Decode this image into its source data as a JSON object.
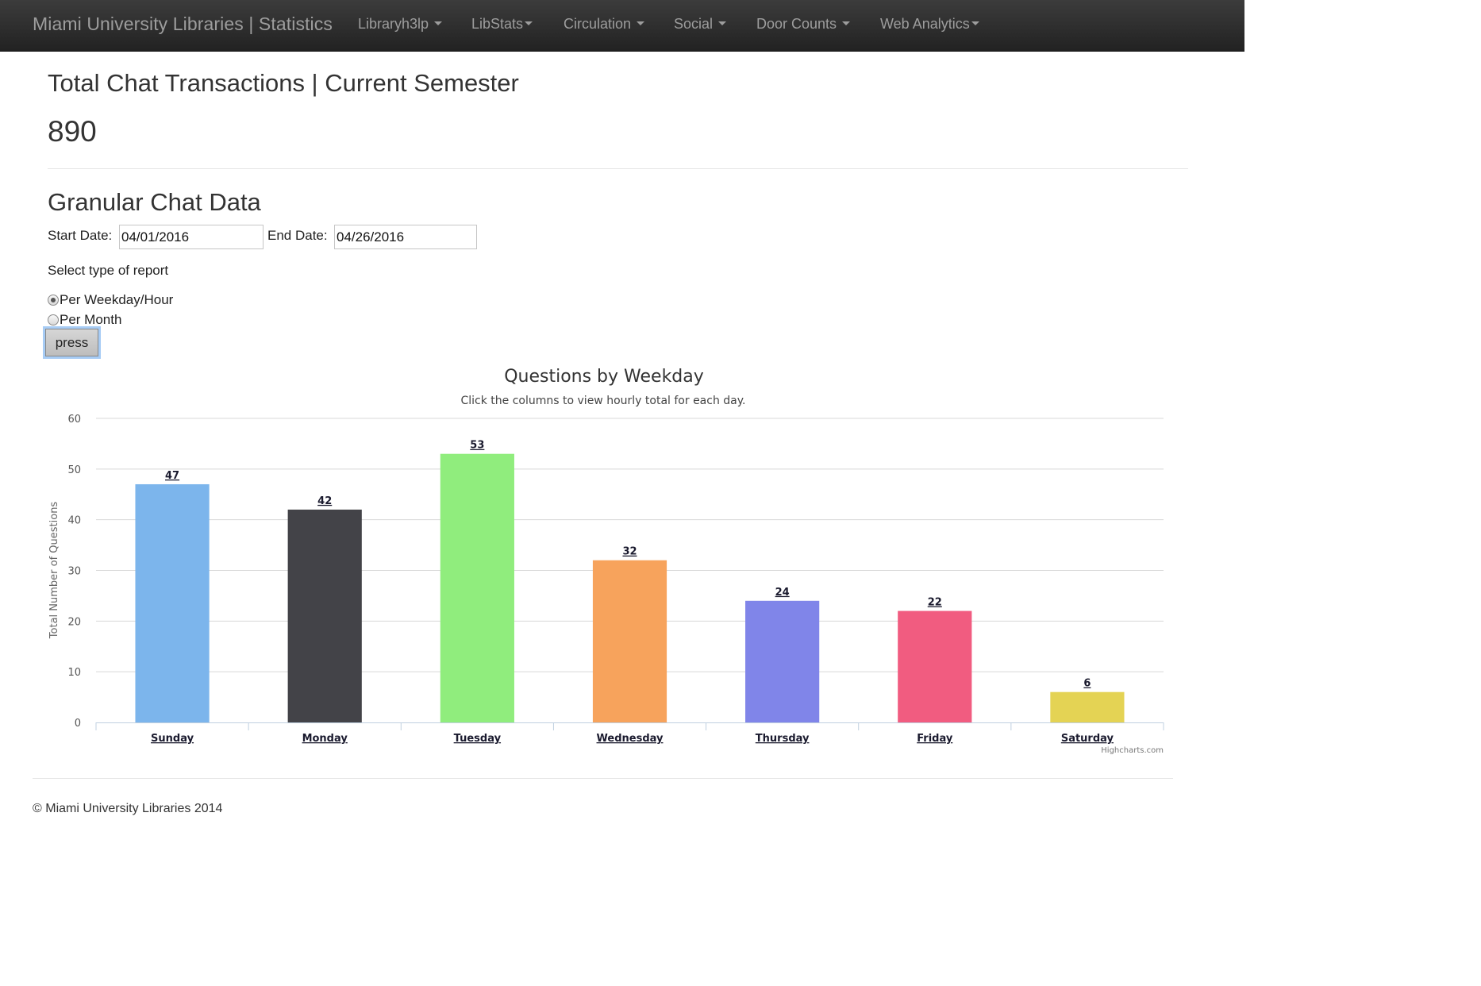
{
  "navbar": {
    "brand": "Miami University Libraries | Statistics",
    "items": [
      {
        "label": "Libraryh3lp"
      },
      {
        "label": "LibStats"
      },
      {
        "label": "Circulation"
      },
      {
        "label": "Social"
      },
      {
        "label": "Door Counts"
      },
      {
        "label": "Web Analytics"
      }
    ]
  },
  "summary": {
    "title": "Total Chat Transactions | Current Semester",
    "total": "890"
  },
  "form": {
    "section_title": "Granular Chat Data",
    "start_label": "Start Date:",
    "start_value": "04/01/2016",
    "end_label": "End Date:",
    "end_value": "04/26/2016",
    "report_label": "Select type of report",
    "options": [
      {
        "label": "Per Weekday/Hour",
        "checked": true
      },
      {
        "label": "Per Month",
        "checked": false
      }
    ],
    "submit_label": "press"
  },
  "chart_data": {
    "type": "bar",
    "title": "Questions by Weekday",
    "subtitle": "Click the columns to view hourly total for each day.",
    "ylabel": "Total Number of Questions",
    "xlabel": "",
    "categories": [
      "Sunday",
      "Monday",
      "Tuesday",
      "Wednesday",
      "Thursday",
      "Friday",
      "Saturday"
    ],
    "values": [
      47,
      42,
      53,
      32,
      24,
      22,
      6
    ],
    "colors": [
      "#7cb5ec",
      "#434348",
      "#90ed7d",
      "#f7a35c",
      "#8085e9",
      "#f15c80",
      "#e4d354"
    ],
    "ylim": [
      0,
      60
    ],
    "yticks": [
      0,
      10,
      20,
      30,
      40,
      50,
      60
    ],
    "grid": true,
    "data_labels": true,
    "legend": "none",
    "credits": "Highcharts.com"
  },
  "footer": {
    "text": "© Miami University Libraries 2014"
  }
}
